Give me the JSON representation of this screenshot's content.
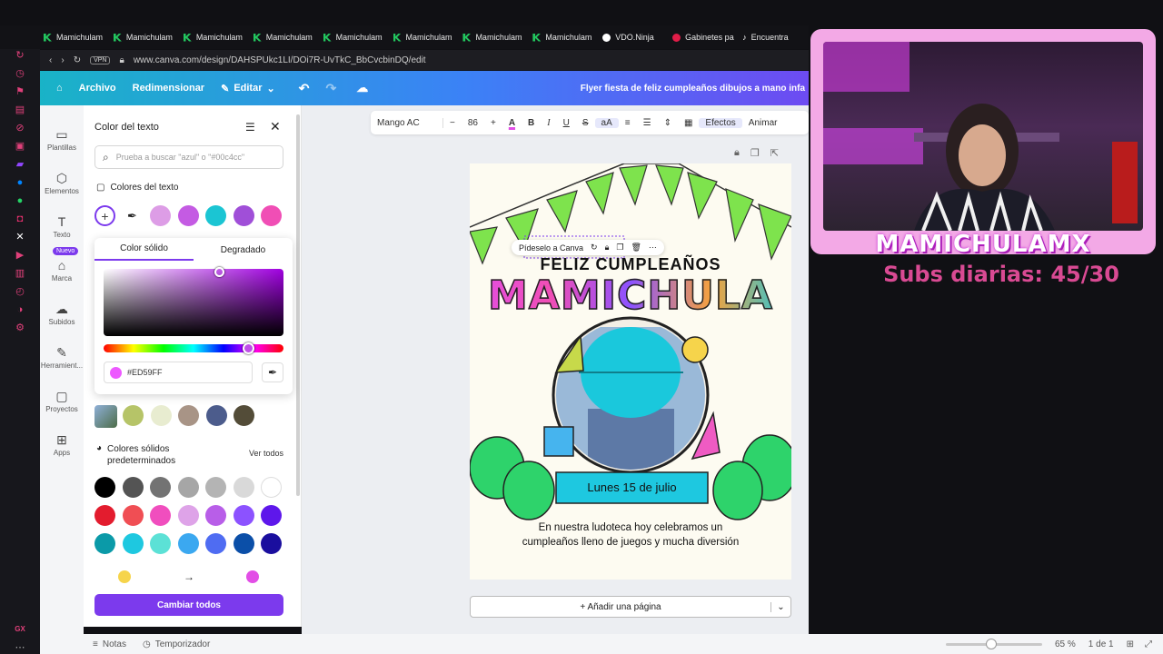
{
  "browser": {
    "tabs": [
      {
        "label": "Mamichulam",
        "icon": "kick"
      },
      {
        "label": "Mamichulam",
        "icon": "kick"
      },
      {
        "label": "Mamichulam",
        "icon": "kick"
      },
      {
        "label": "Mamichulam",
        "icon": "kick"
      },
      {
        "label": "Mamichulam",
        "icon": "kick"
      },
      {
        "label": "Mamichulam",
        "icon": "kick"
      },
      {
        "label": "Mamichulam",
        "icon": "kick"
      },
      {
        "label": "Mamichulam",
        "icon": "kick"
      },
      {
        "label": "VDO.Ninja",
        "icon": "vdo"
      },
      {
        "label": "Gabinetes pa",
        "icon": "gabinetes"
      },
      {
        "label": "Encuentra",
        "icon": "tiktok"
      }
    ],
    "vpn": "VPN",
    "url": "www.canva.com/design/DAHSPUkc1LI/DOi7R-UvTkC_BbCvcbinDQ/edit",
    "gx": "GX"
  },
  "header": {
    "archivo": "Archivo",
    "redimensionar": "Redimensionar",
    "editar": "Editar",
    "title": "Flyer fiesta de feliz cumpleaños dibujos a mano infa"
  },
  "nav": [
    {
      "label": "Plantillas",
      "icon": "template-icon",
      "glyph": "▭"
    },
    {
      "label": "Elementos",
      "icon": "elements-icon",
      "glyph": "⬡"
    },
    {
      "label": "Texto",
      "icon": "text-icon",
      "glyph": "T"
    },
    {
      "label": "Marca",
      "icon": "brand-icon",
      "glyph": "⌂",
      "badge": "Nuevo"
    },
    {
      "label": "Subidos",
      "icon": "upload-icon",
      "glyph": "☁"
    },
    {
      "label": "Herramient...",
      "icon": "tools-icon",
      "glyph": "✎"
    },
    {
      "label": "Proyectos",
      "icon": "folder-icon",
      "glyph": "▢"
    },
    {
      "label": "Apps",
      "icon": "apps-icon",
      "glyph": "⊞"
    }
  ],
  "panel": {
    "title": "Color del texto",
    "search_placeholder": "Prueba a buscar \"azul\" o \"#00c4cc\"",
    "text_colors_heading": "Colores del texto",
    "text_colors": [
      "#dd9de6",
      "#c45be3",
      "#1bc5d3",
      "#a04fd8",
      "#f04eb5"
    ],
    "tab_solid": "Color sólido",
    "tab_gradient": "Degradado",
    "hex_value": "#ED59FF",
    "photo_colors": [
      "#b6c468",
      "#e8ecd0",
      "#a89486",
      "#4c5c8c",
      "#534c38"
    ],
    "default_heading": "Colores sólidos predeterminados",
    "ver_todos": "Ver todos",
    "default_colors": [
      [
        "#000000",
        "#545454",
        "#737373",
        "#a6a6a6",
        "#b4b4b4",
        "#d9d9d9",
        "#ffffff"
      ],
      [
        "#e31c2e",
        "#f04e54",
        "#f04ebe",
        "#dea3e8",
        "#b85ee8",
        "#8c52ff",
        "#5e17eb"
      ],
      [
        "#0b9aa8",
        "#1ec8e0",
        "#5ce1d6",
        "#3ba8f0",
        "#4f6cf2",
        "#0b4fa8",
        "#1a0e9e"
      ]
    ],
    "gradient_from": "#f6d44b",
    "gradient_to": "#e24ee6",
    "cambiar_todos": "Cambiar todos"
  },
  "toolbar": {
    "font": "Mango AC",
    "size": "86",
    "efectos": "Efectos",
    "animar": "Animar"
  },
  "canvas": {
    "pideselo": "Pídeselo a Canva",
    "feliz": "FELIZ CUMPLEAÑOS",
    "name": "MAMICHULA",
    "date": "Lunes 15 de julio",
    "body1": "En nuestra ludoteca hoy celebramos un",
    "body2": "cumpleaños lleno de juegos y mucha diversión"
  },
  "add_page": "+ Añadir una página",
  "bottom": {
    "notas": "Notas",
    "temporizador": "Temporizador",
    "zoom": "65 %",
    "pages": "1 de 1"
  },
  "stream": {
    "channel": "MAMICHULAMX",
    "subs": "Subs diarias: 45/30"
  }
}
